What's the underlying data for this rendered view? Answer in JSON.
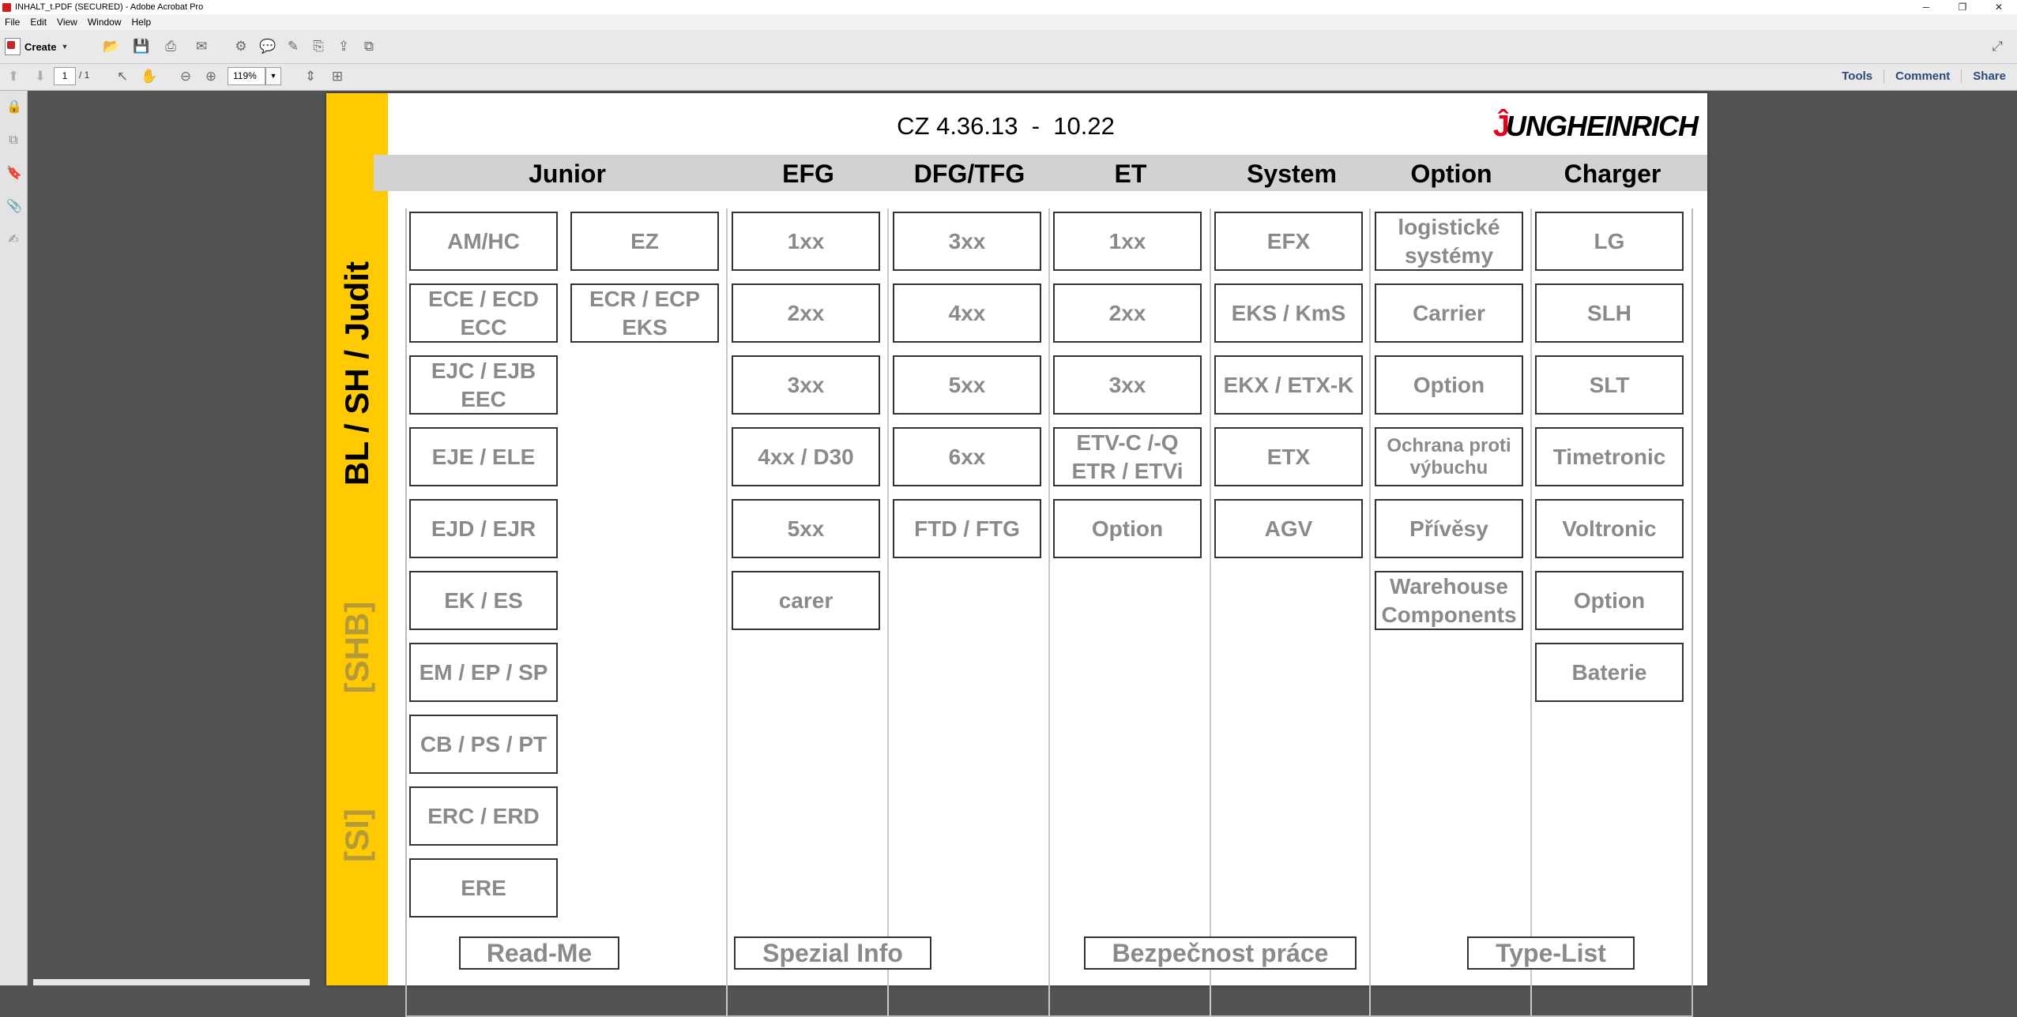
{
  "window": {
    "title": "INHALT_t.PDF (SECURED) - Adobe Acrobat Pro",
    "controls": {
      "minimize": "─",
      "maximize": "❐",
      "close": "✕"
    }
  },
  "menu": [
    "File",
    "Edit",
    "View",
    "Window",
    "Help"
  ],
  "toolbar": {
    "create_label": "Create",
    "page_current": "1",
    "page_total": "/ 1",
    "zoom": "119%",
    "right_links": [
      "Tools",
      "Comment",
      "Share"
    ]
  },
  "document": {
    "title": "CZ 4.36.13  -  10.22",
    "logo_text": "UNGHEINRICH",
    "side_labels": {
      "main": "BL / SH / Judit",
      "shb": "[SHB]",
      "si": "[SI]"
    },
    "columns": [
      {
        "id": "junior",
        "header": "Junior"
      },
      {
        "id": "efg",
        "header": "EFG"
      },
      {
        "id": "dfg",
        "header": "DFG/TFG"
      },
      {
        "id": "et",
        "header": "ET"
      },
      {
        "id": "system",
        "header": "System"
      },
      {
        "id": "option",
        "header": "Option"
      },
      {
        "id": "charger",
        "header": "Charger"
      }
    ],
    "junior_a": [
      "AM/HC",
      "ECE / ECD\nECC",
      "EJC / EJB\nEEC",
      "EJE / ELE",
      "EJD / EJR",
      "EK / ES",
      "EM / EP / SP",
      "CB / PS / PT",
      "ERC / ERD",
      "ERE"
    ],
    "junior_b": [
      "EZ",
      "ECR / ECP\nEKS"
    ],
    "efg": [
      "1xx",
      "2xx",
      "3xx",
      "4xx / D30",
      "5xx",
      "carer"
    ],
    "dfg": [
      "3xx",
      "4xx",
      "5xx",
      "6xx",
      "FTD / FTG"
    ],
    "et": [
      "1xx",
      "2xx",
      "3xx",
      "ETV-C /-Q\nETR / ETVi",
      "Option"
    ],
    "system": [
      "EFX",
      "EKS / KmS",
      "EKX / ETX-K",
      "ETX",
      "AGV"
    ],
    "option": [
      "logistické\nsystémy",
      "Carrier",
      "Option",
      "Ochrana proti\nvýbuchu",
      "Přívěsy",
      "Warehouse\nComponents"
    ],
    "charger": [
      "LG",
      "SLH",
      "SLT",
      "Timetronic",
      "Voltronic",
      "Option",
      "Baterie"
    ],
    "bottom_buttons": [
      "Read-Me",
      "Spezial Info",
      "Bezpečnost práce",
      "Type-List"
    ]
  },
  "colors": {
    "band": "#ffcb00",
    "header_band": "#d2d2d2",
    "button_text": "#8a8a8a",
    "logo_accent": "#e2001a"
  }
}
